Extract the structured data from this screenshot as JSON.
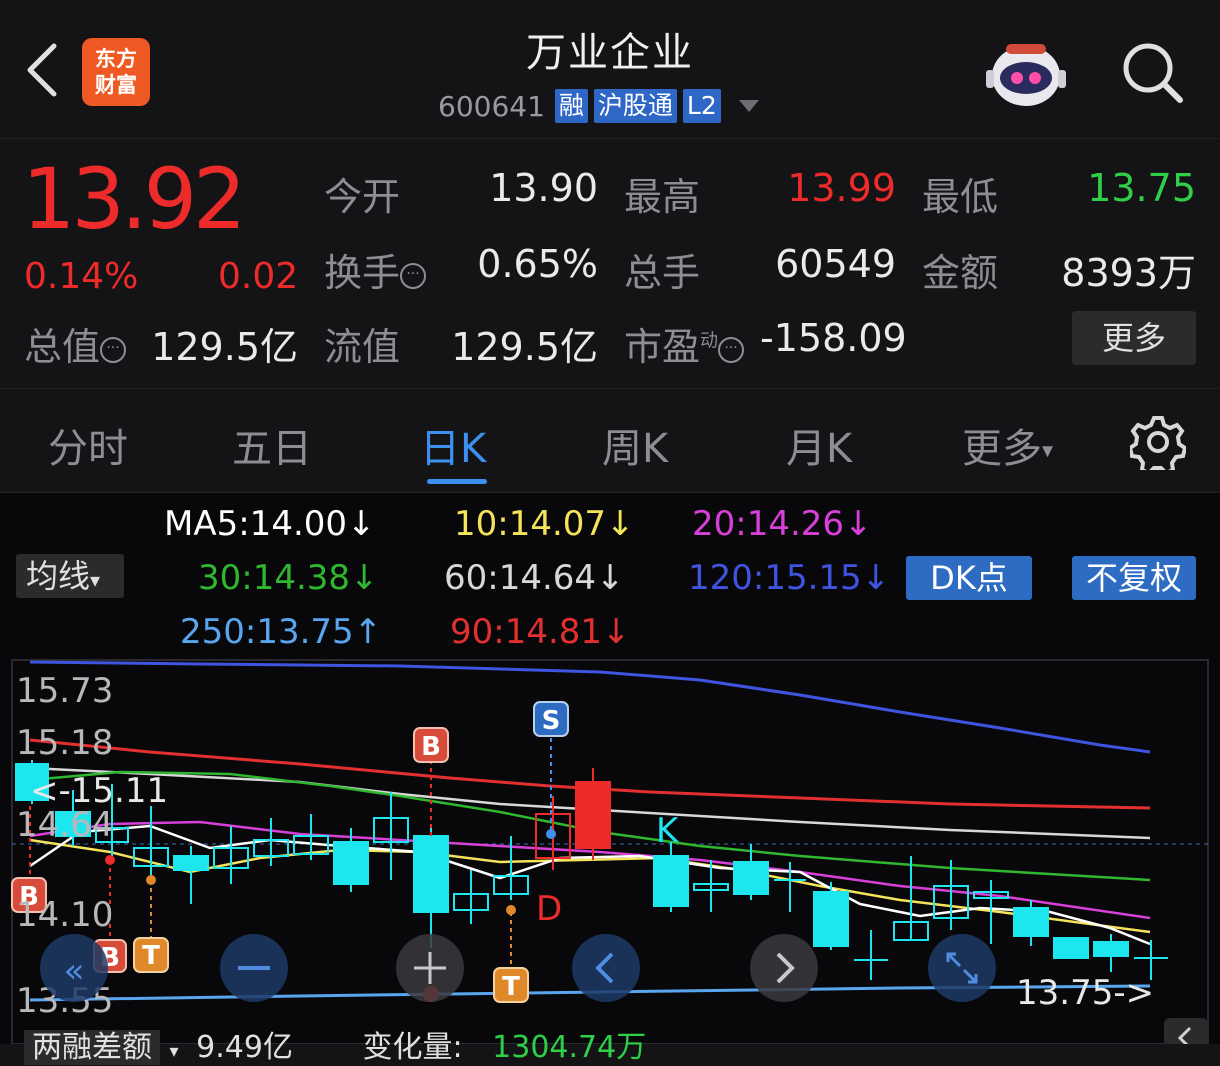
{
  "header": {
    "title": "万业企业",
    "logo_lines": [
      "东方",
      "财富"
    ],
    "code": "600641",
    "tags": [
      "融",
      "沪股通",
      "L2"
    ]
  },
  "quote": {
    "price": "13.92",
    "pct": "0.14%",
    "change": "0.02",
    "fields": {
      "open_label": "今开",
      "open": "13.90",
      "high_label": "最高",
      "high": "13.99",
      "low_label": "最低",
      "low": "13.75",
      "turnover_label": "换手",
      "turnover": "0.65%",
      "volume_label": "总手",
      "volume": "60549",
      "amount_label": "金额",
      "amount": "8393万",
      "mktcap_label": "总值",
      "mktcap": "129.5亿",
      "float_label": "流值",
      "float": "129.5亿",
      "pe_label": "市盈",
      "pe_sup": "动",
      "pe": "-158.09"
    },
    "more_button": "更多"
  },
  "tabs": [
    {
      "label": "分时"
    },
    {
      "label": "五日"
    },
    {
      "label": "日K"
    },
    {
      "label": "周K"
    },
    {
      "label": "月K"
    },
    {
      "label": "更多"
    }
  ],
  "ma_legend": {
    "ma5": "MA5:14.00↓",
    "ma10": "10:14.07↓",
    "ma20": "20:14.26↓",
    "ma30": "30:14.38↓",
    "ma60": "60:14.64↓",
    "ma120": "120:15.15↓",
    "ma250": "250:13.75↑",
    "ma90": "90:14.81↓",
    "avg_button": "均线",
    "dk_button": "DK点",
    "fq_button": "不复权"
  },
  "colors": {
    "up": "#ee2b2b",
    "down": "#1ee6ef",
    "ma5": "#ffffff",
    "ma10": "#f5e35a",
    "ma20": "#d93fd9",
    "ma30": "#2fb82f",
    "ma60": "#d8d8d8",
    "ma120": "#3f54e0",
    "ma250": "#5aa6ee",
    "ma90": "#e23030"
  },
  "axis": {
    "y_labels": [
      "15.73",
      "15.18",
      "14.64",
      "14.10",
      "13.55"
    ],
    "max_marker": "<-15.11",
    "min_marker": "13.75->",
    "k_marker": "K",
    "d_marker": "D"
  },
  "signals": {
    "b": "B",
    "s": "S",
    "t": "T"
  },
  "footer": {
    "label": "两融差额",
    "value": "9.49亿",
    "change_label": "变化量:",
    "change_value": "1304.74万"
  }
}
